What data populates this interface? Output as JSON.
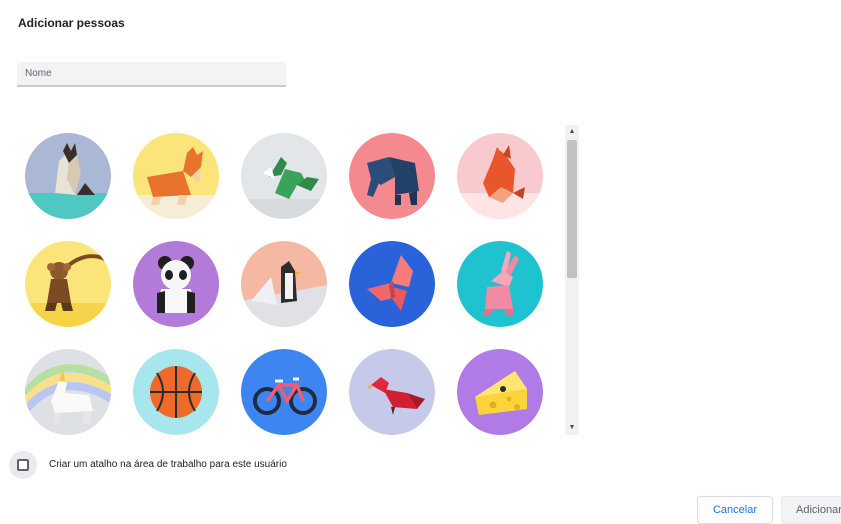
{
  "dialog": {
    "title": "Adicionar pessoas"
  },
  "name_input": {
    "placeholder": "Nome",
    "value": ""
  },
  "avatars": [
    {
      "name": "cat-avatar",
      "bg": "#aab8d6"
    },
    {
      "name": "corgi-avatar",
      "bg": "#fbe57a"
    },
    {
      "name": "dragon-avatar",
      "bg": "#e3e6e8"
    },
    {
      "name": "elephant-avatar",
      "bg": "#f48a90"
    },
    {
      "name": "fox-avatar",
      "bg": "#f8c9cd"
    },
    {
      "name": "monkey-avatar",
      "bg": "#fbe57a"
    },
    {
      "name": "panda-avatar",
      "bg": "#b27ad9"
    },
    {
      "name": "penguin-avatar",
      "bg": "#f5b8a2"
    },
    {
      "name": "butterfly-avatar",
      "bg": "#2a63d9"
    },
    {
      "name": "rabbit-avatar",
      "bg": "#1fc3cf"
    },
    {
      "name": "unicorn-avatar",
      "bg": "#dde0e4"
    },
    {
      "name": "basketball-avatar",
      "bg": "#a8e6ee"
    },
    {
      "name": "bicycle-avatar",
      "bg": "#3d86f2"
    },
    {
      "name": "bird-avatar",
      "bg": "#c6c9e9"
    },
    {
      "name": "cheese-avatar",
      "bg": "#b07be6"
    }
  ],
  "shortcut": {
    "label": "Criar um atalho na área de trabalho para este usuário",
    "checked": false
  },
  "buttons": {
    "cancel": "Cancelar",
    "add": "Adicionar"
  },
  "scrollbar": {
    "up_icon": "▲",
    "down_icon": "▼"
  }
}
